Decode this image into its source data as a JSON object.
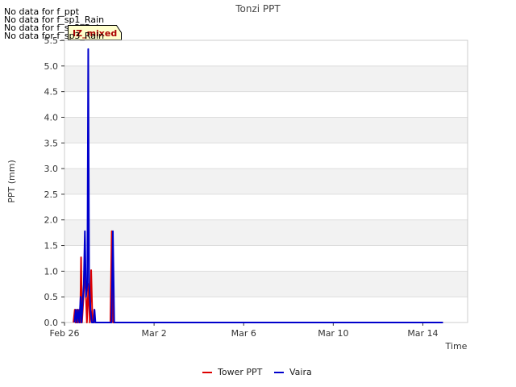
{
  "notices": [
    "No data for f_ppt",
    "No data for f_sp1_Rain",
    "No data for f_sp2_Rain",
    "No data for f_sp3_Rain"
  ],
  "badge": {
    "label": "IZ_mixed"
  },
  "chart_data": {
    "type": "line",
    "title": "Tonzi PPT",
    "xlabel": "Time",
    "ylabel": "PPT (mm)",
    "ylim": [
      0,
      5.5
    ],
    "xlim_days": [
      0,
      18
    ],
    "y_ticks": [
      0.0,
      0.5,
      1.0,
      1.5,
      2.0,
      2.5,
      3.0,
      3.5,
      4.0,
      4.5,
      5.0,
      5.5
    ],
    "y_tick_labels": [
      "0.0",
      "0.5",
      "1.0",
      "1.5",
      "2.0",
      "2.5",
      "3.0",
      "3.5",
      "4.0",
      "4.5",
      "5.0",
      "5.5"
    ],
    "x_ticks": [
      0,
      4,
      8,
      12,
      16
    ],
    "x_tick_labels": [
      "Feb 26",
      "Mar 2",
      "Mar 6",
      "Mar 10",
      "Mar 14"
    ],
    "grid": true,
    "legend_position": "bottom-center",
    "series": [
      {
        "name": "Tower PPT",
        "color": "#dd0000",
        "points": [
          [
            0.4,
            0
          ],
          [
            0.46,
            0.25
          ],
          [
            0.5,
            0
          ],
          [
            0.56,
            0.25
          ],
          [
            0.6,
            0
          ],
          [
            0.66,
            0.25
          ],
          [
            0.7,
            0
          ],
          [
            0.74,
            1.27
          ],
          [
            0.78,
            0
          ],
          [
            0.85,
            0.5
          ],
          [
            0.92,
            1.0
          ],
          [
            1.0,
            0
          ],
          [
            1.07,
            0.75
          ],
          [
            1.13,
            0
          ],
          [
            1.19,
            1.02
          ],
          [
            1.25,
            0
          ],
          [
            1.3,
            0
          ],
          [
            1.33,
            0.25
          ],
          [
            1.36,
            0
          ],
          [
            2.05,
            0
          ],
          [
            2.11,
            1.78
          ],
          [
            2.17,
            0
          ],
          [
            16.9,
            0
          ]
        ]
      },
      {
        "name": "Vaira",
        "color": "#0000cc",
        "points": [
          [
            0.45,
            0
          ],
          [
            0.5,
            0.25
          ],
          [
            0.55,
            0
          ],
          [
            0.6,
            0.25
          ],
          [
            0.66,
            0
          ],
          [
            0.72,
            0.5
          ],
          [
            0.76,
            0
          ],
          [
            0.86,
            0.75
          ],
          [
            0.91,
            1.78
          ],
          [
            0.96,
            0.5
          ],
          [
            1.02,
            0.75
          ],
          [
            1.06,
            5.33
          ],
          [
            1.1,
            0.75
          ],
          [
            1.16,
            0.25
          ],
          [
            1.22,
            0
          ],
          [
            1.3,
            0
          ],
          [
            1.34,
            0.25
          ],
          [
            1.38,
            0
          ],
          [
            2.1,
            0
          ],
          [
            2.16,
            1.78
          ],
          [
            2.22,
            0
          ],
          [
            16.9,
            0
          ]
        ]
      }
    ]
  }
}
